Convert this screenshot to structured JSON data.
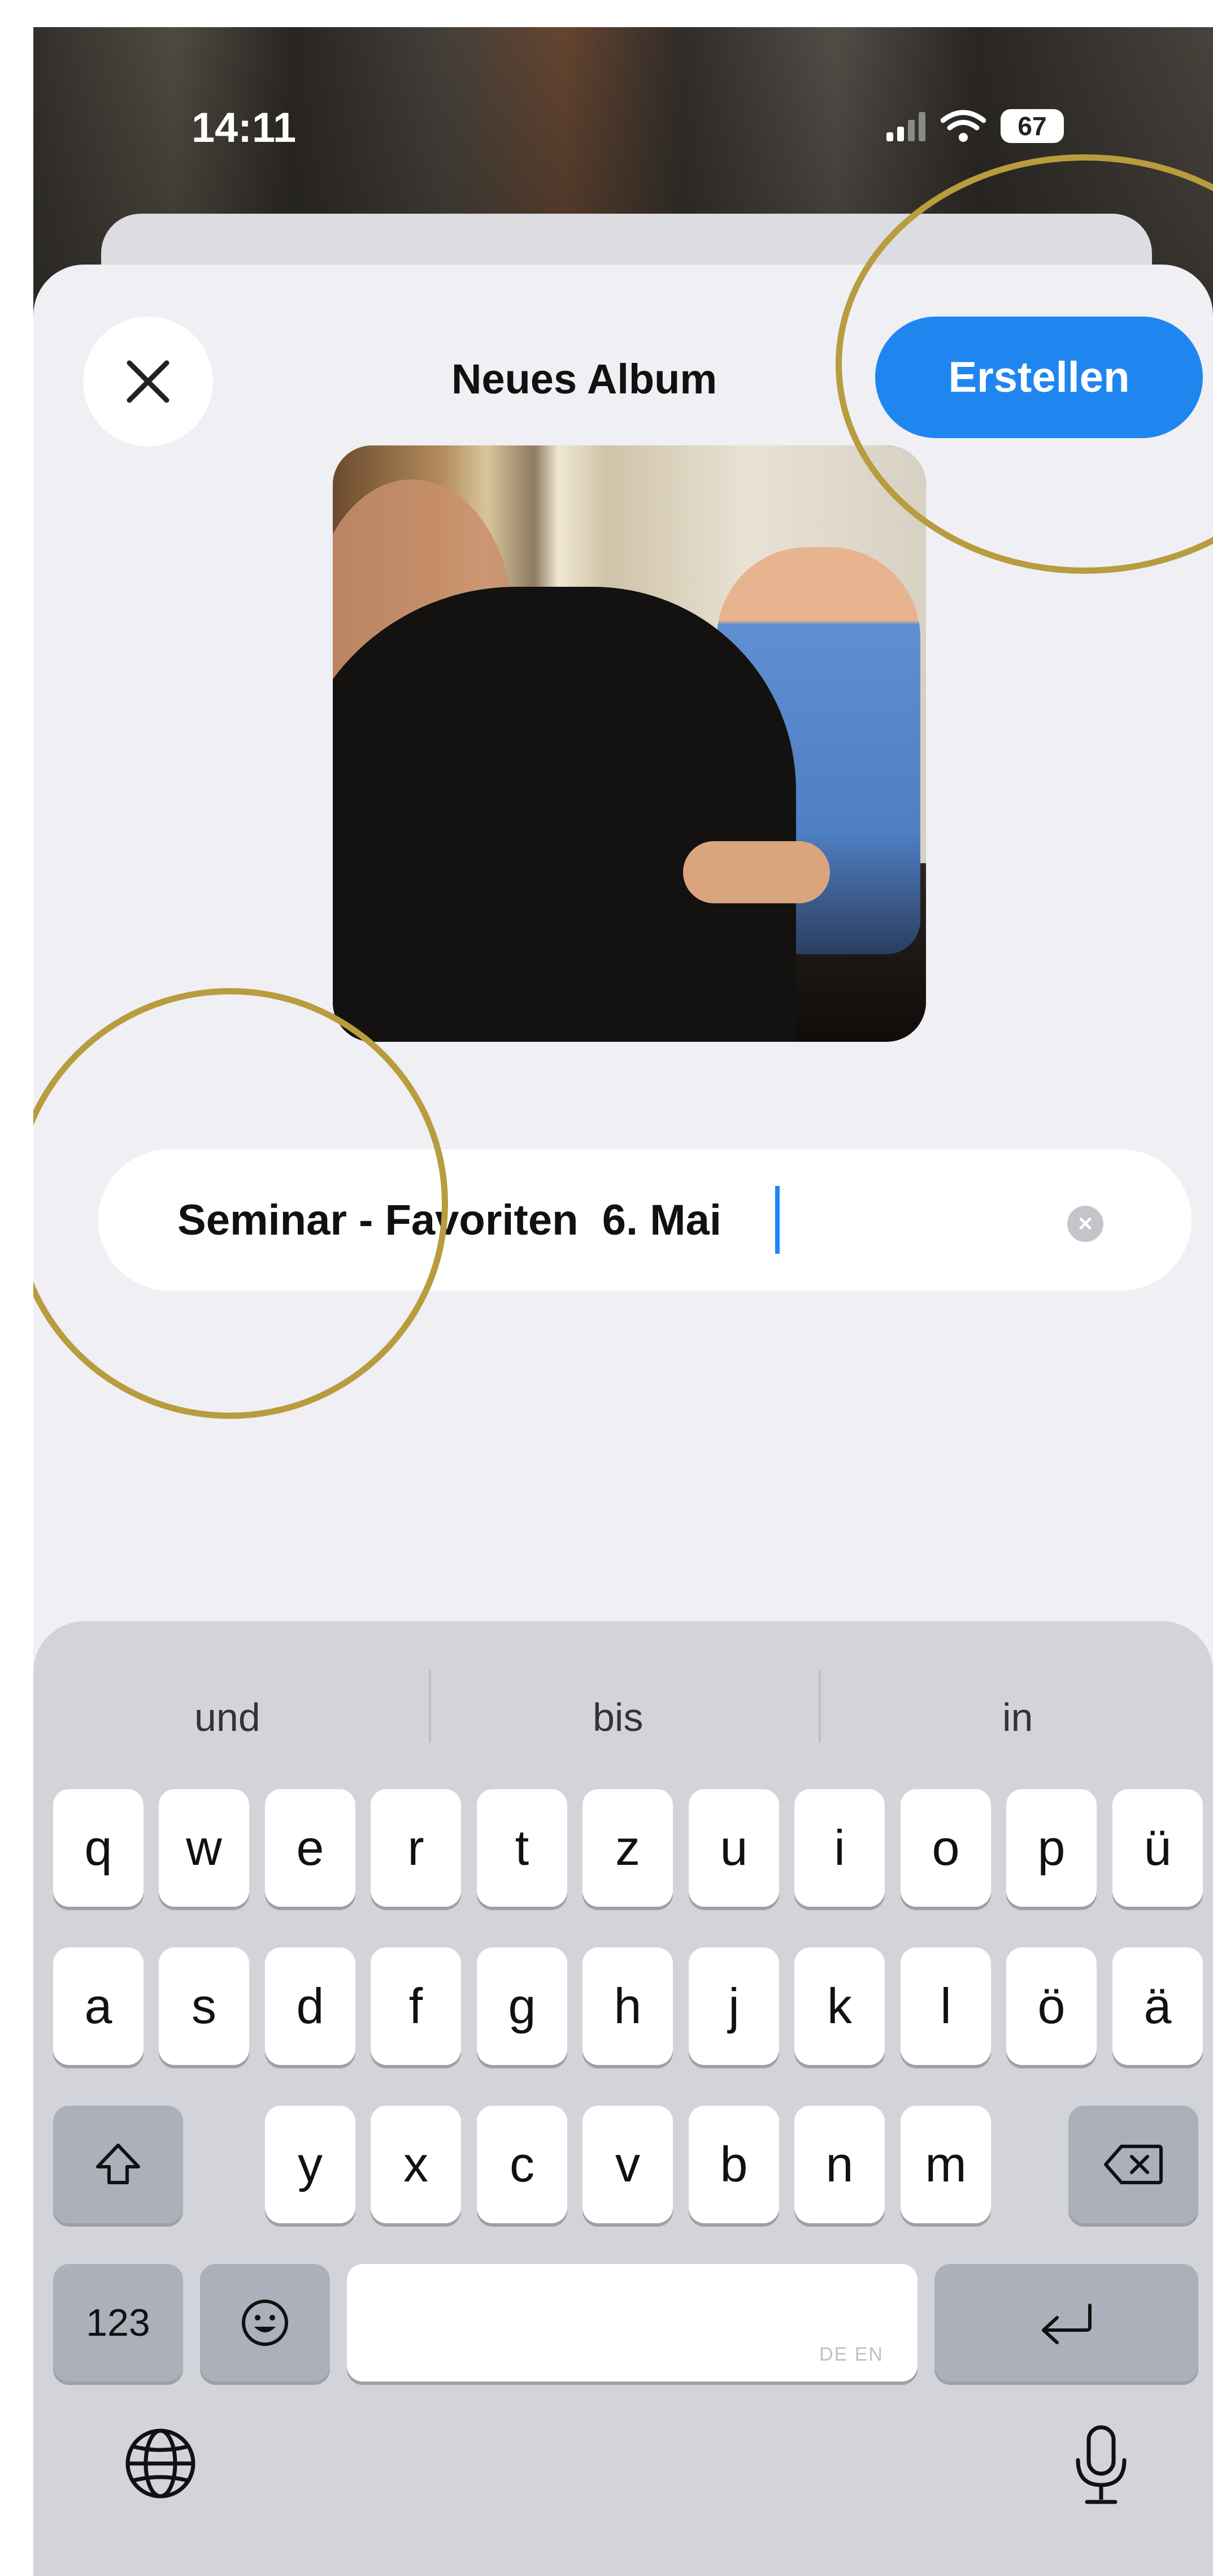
{
  "status_bar": {
    "time": "14:11",
    "battery": "67"
  },
  "header": {
    "title": "Neues Album",
    "create_label": "Erstellen"
  },
  "album_name": {
    "value": "Seminar - Favoriten  6. Mai"
  },
  "keyboard": {
    "suggestions": [
      "und",
      "bis",
      "in"
    ],
    "row1": [
      "q",
      "w",
      "e",
      "r",
      "t",
      "z",
      "u",
      "i",
      "o",
      "p",
      "ü"
    ],
    "row2": [
      "a",
      "s",
      "d",
      "f",
      "g",
      "h",
      "j",
      "k",
      "l",
      "ö",
      "ä"
    ],
    "row3": [
      "y",
      "x",
      "c",
      "v",
      "b",
      "n",
      "m"
    ],
    "numbers_label": "123",
    "space_languages": "DE EN"
  },
  "colors": {
    "accent": "#1f86f0",
    "highlight_ring": "#b89c3d"
  }
}
